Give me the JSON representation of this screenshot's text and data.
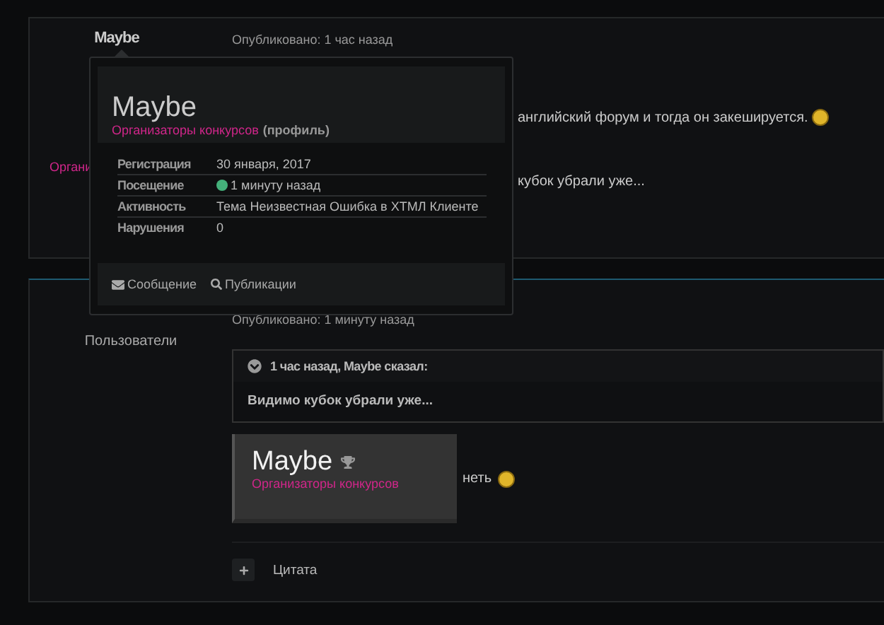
{
  "post1": {
    "author": "Maybe",
    "author_group": "Органи",
    "meta": "Опубликовано: 1 час назад",
    "body_lines": [
      "английский форум и тогда он закешируется.",
      "кубок убрали уже..."
    ]
  },
  "popover": {
    "name": "Maybe",
    "group": "Организаторы конкурсов",
    "profile_link": "(профиль)",
    "rows": [
      {
        "label": "Регистрация",
        "value": "30 января, 2017",
        "online": false
      },
      {
        "label": "Посещение",
        "value": "1 минуту назад",
        "online": true
      },
      {
        "label": "Активность",
        "value": "Тема Неизвестная Ошибка в ХТМЛ Клиенте",
        "online": false
      },
      {
        "label": "Нарушения",
        "value": "0",
        "online": false
      }
    ],
    "actions": [
      {
        "kind": "message",
        "label": "Сообщение"
      },
      {
        "kind": "search",
        "label": "Публикации"
      }
    ]
  },
  "post2": {
    "author_group": "Пользователи",
    "meta": "Опубликовано: 1 минуту назад",
    "quote": {
      "header": "1 час назад, Maybe сказал:",
      "text": "Видимо кубок убрали уже...",
      "expanded": true
    },
    "signature": {
      "name": "Maybe",
      "group": "Организаторы конкурсов"
    },
    "reply_text": "неть",
    "action": {
      "label": "Цитата"
    }
  }
}
